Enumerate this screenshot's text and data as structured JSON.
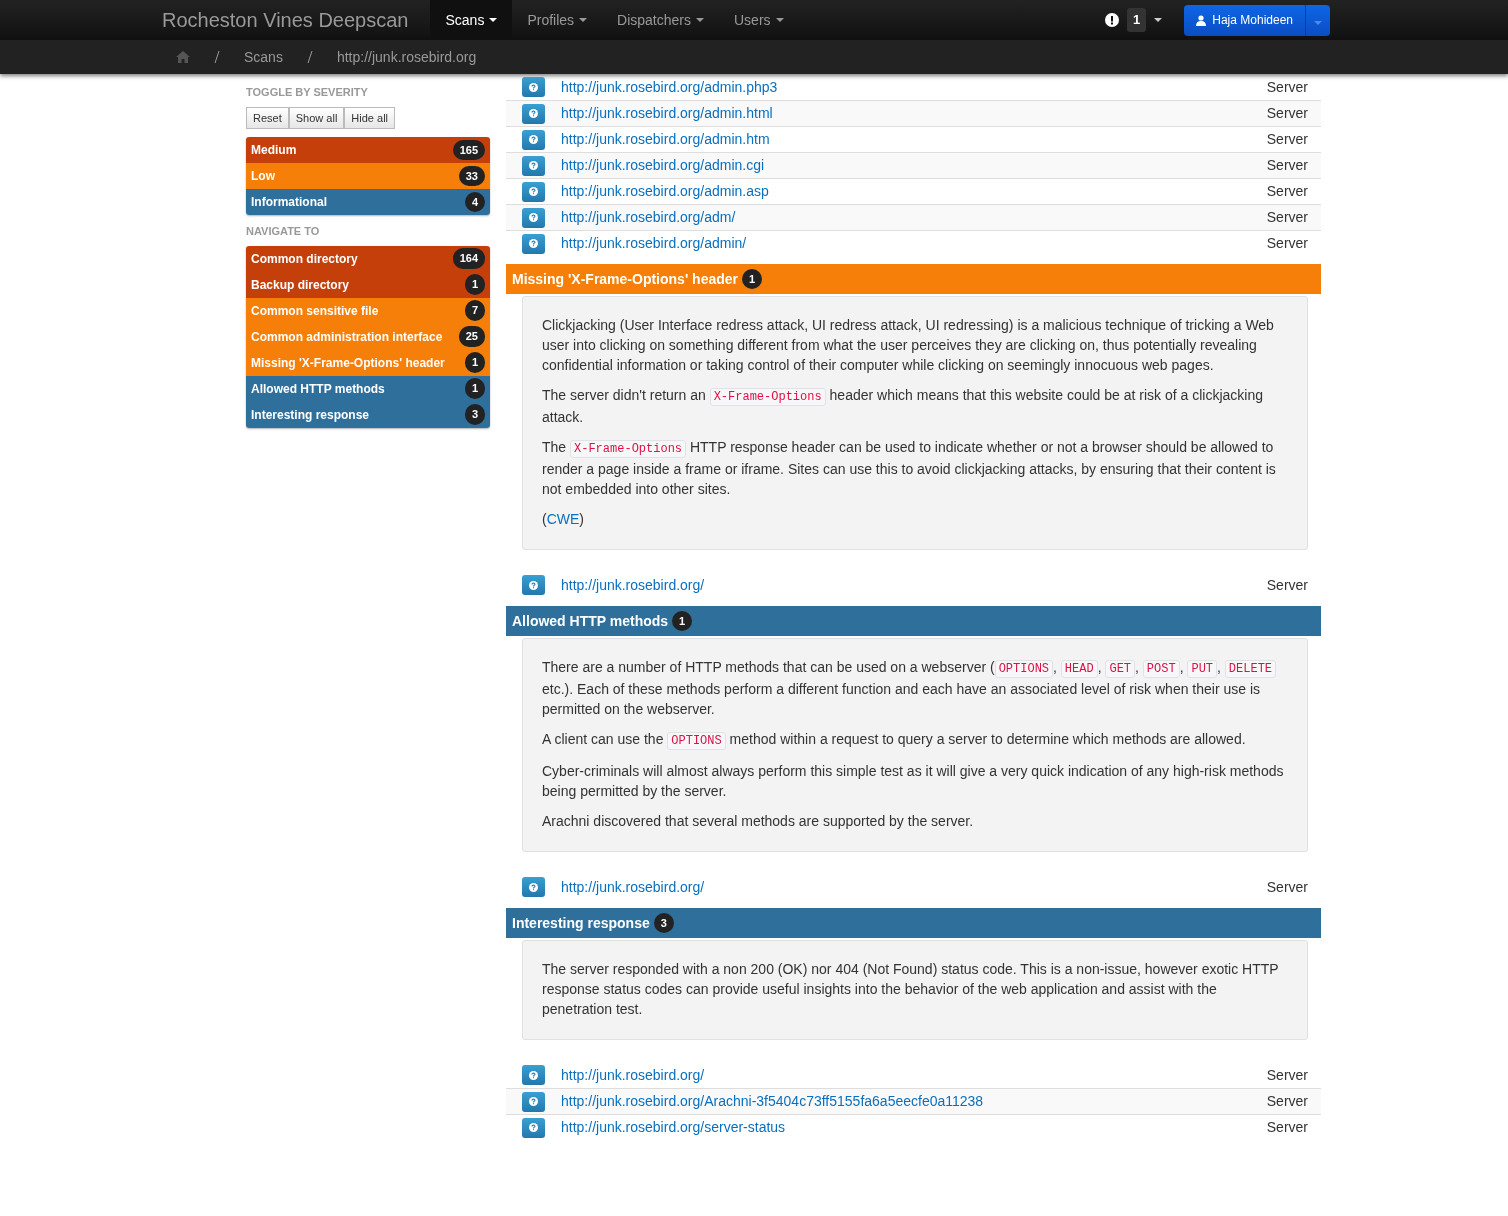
{
  "navbar": {
    "brand": "Rocheston Vines Deepscan",
    "menus": [
      {
        "label": "Scans",
        "selected": true
      },
      {
        "label": "Profiles",
        "selected": false
      },
      {
        "label": "Dispatchers",
        "selected": false
      },
      {
        "label": "Users",
        "selected": false
      }
    ],
    "notifications": "1",
    "user": "Haja Mohideen"
  },
  "breadcrumb": [
    "Scans",
    "http://junk.rosebird.org"
  ],
  "sidebar": {
    "toggle_heading": "TOGGLE BY SEVERITY",
    "toggle_buttons": [
      "Reset",
      "Show all",
      "Hide all"
    ],
    "severities": [
      {
        "label": "Medium",
        "count": "165",
        "color": "#c53f0b"
      },
      {
        "label": "Low",
        "count": "33",
        "color": "#f57f08"
      },
      {
        "label": "Informational",
        "count": "4",
        "color": "#2f6f9c"
      }
    ],
    "navigate_heading": "NAVIGATE TO",
    "navigate": [
      {
        "label": "Common directory",
        "count": "164",
        "color": "#c53f0b"
      },
      {
        "label": "Backup directory",
        "count": "1",
        "color": "#c53f0b"
      },
      {
        "label": "Common sensitive file",
        "count": "7",
        "color": "#f57f08"
      },
      {
        "label": "Common administration interface",
        "count": "25",
        "color": "#f57f08"
      },
      {
        "label": "Missing 'X-Frame-Options' header",
        "count": "1",
        "color": "#f57f08"
      },
      {
        "label": "Allowed HTTP methods",
        "count": "1",
        "color": "#2f6f9c"
      },
      {
        "label": "Interesting response",
        "count": "3",
        "color": "#2f6f9c"
      }
    ]
  },
  "issues": [
    {
      "url": "http://junk.rosebird.org/admin.php3",
      "type": "Server"
    },
    {
      "url": "http://junk.rosebird.org/admin.html",
      "type": "Server"
    },
    {
      "url": "http://junk.rosebird.org/admin.htm",
      "type": "Server"
    },
    {
      "url": "http://junk.rosebird.org/admin.cgi",
      "type": "Server"
    },
    {
      "url": "http://junk.rosebird.org/admin.asp",
      "type": "Server"
    },
    {
      "url": "http://junk.rosebird.org/adm/",
      "type": "Server"
    },
    {
      "url": "http://junk.rosebird.org/admin/",
      "type": "Server"
    }
  ],
  "sections": [
    {
      "title": "Missing 'X-Frame-Options' header",
      "count": "1",
      "color": "#f57f08",
      "paragraphs": [
        [
          {
            "kind": "text",
            "text": "Clickjacking (User Interface redress attack, UI redress attack, UI redressing) is a malicious technique of tricking a Web user into clicking on something different from what the user perceives they are clicking on, thus potentially revealing confidential information or taking control of their computer while clicking on seemingly innocuous web pages."
          }
        ],
        [
          {
            "kind": "text",
            "text": "The server didn't return an "
          },
          {
            "kind": "code",
            "text": "X-Frame-Options"
          },
          {
            "kind": "text",
            "text": " header which means that this website could be at risk of a clickjacking attack."
          }
        ],
        [
          {
            "kind": "text",
            "text": "The "
          },
          {
            "kind": "code",
            "text": "X-Frame-Options"
          },
          {
            "kind": "text",
            "text": " HTTP response header can be used to indicate whether or not a browser should be allowed to render a page inside a frame or iframe. Sites can use this to avoid clickjacking attacks, by ensuring that their content is not embedded into other sites."
          }
        ],
        [
          {
            "kind": "text",
            "text": "("
          },
          {
            "kind": "link",
            "text": "CWE"
          },
          {
            "kind": "text",
            "text": ")"
          }
        ]
      ],
      "rows": [
        {
          "url": "http://junk.rosebird.org/",
          "type": "Server"
        }
      ]
    },
    {
      "title": "Allowed HTTP methods",
      "count": "1",
      "color": "#2f6f9c",
      "paragraphs": [
        [
          {
            "kind": "text",
            "text": "There are a number of HTTP methods that can be used on a webserver ("
          },
          {
            "kind": "code",
            "text": "OPTIONS"
          },
          {
            "kind": "text",
            "text": ", "
          },
          {
            "kind": "code",
            "text": "HEAD"
          },
          {
            "kind": "text",
            "text": ", "
          },
          {
            "kind": "code",
            "text": "GET"
          },
          {
            "kind": "text",
            "text": ", "
          },
          {
            "kind": "code",
            "text": "POST"
          },
          {
            "kind": "text",
            "text": ", "
          },
          {
            "kind": "code",
            "text": "PUT"
          },
          {
            "kind": "text",
            "text": ", "
          },
          {
            "kind": "code",
            "text": "DELETE"
          },
          {
            "kind": "text",
            "text": " etc.). Each of these methods perform a different function and each have an associated level of risk when their use is permitted on the webserver."
          }
        ],
        [
          {
            "kind": "text",
            "text": "A client can use the "
          },
          {
            "kind": "code",
            "text": "OPTIONS"
          },
          {
            "kind": "text",
            "text": " method within a request to query a server to determine which methods are allowed."
          }
        ],
        [
          {
            "kind": "text",
            "text": "Cyber-criminals will almost always perform this simple test as it will give a very quick indication of any high-risk methods being permitted by the server."
          }
        ],
        [
          {
            "kind": "text",
            "text": "Arachni discovered that several methods are supported by the server."
          }
        ]
      ],
      "rows": [
        {
          "url": "http://junk.rosebird.org/",
          "type": "Server"
        }
      ]
    },
    {
      "title": "Interesting response",
      "count": "3",
      "color": "#2f6f9c",
      "paragraphs": [
        [
          {
            "kind": "text",
            "text": "The server responded with a non 200 (OK) nor 404 (Not Found) status code. This is a non-issue, however exotic HTTP response status codes can provide useful insights into the behavior of the web application and assist with the penetration test."
          }
        ]
      ],
      "rows": [
        {
          "url": "http://junk.rosebird.org/",
          "type": "Server"
        },
        {
          "url": "http://junk.rosebird.org/Arachni-3f5404c73ff5155fa6a5eecfe0a11238",
          "type": "Server"
        },
        {
          "url": "http://junk.rosebird.org/server-status",
          "type": "Server"
        }
      ]
    }
  ]
}
